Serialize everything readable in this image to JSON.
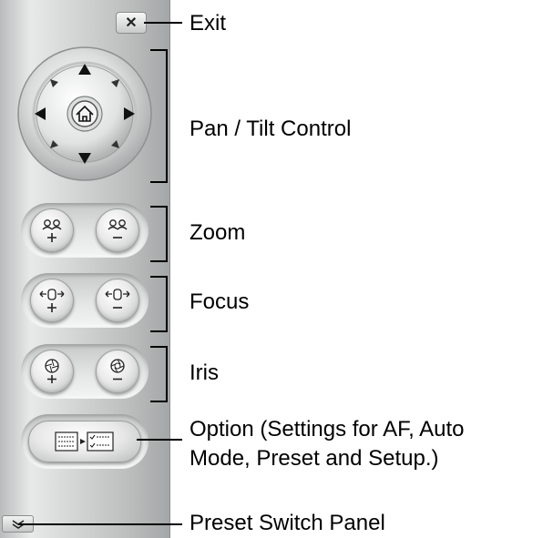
{
  "labels": {
    "exit": "Exit",
    "pan_tilt": "Pan / Tilt Control",
    "zoom": "Zoom",
    "focus": "Focus",
    "iris": "Iris",
    "option_line1": "Option (Settings for AF, Auto",
    "option_line2": "Mode, Preset and Setup.)",
    "preset_switch": "Preset Switch Panel"
  },
  "buttons": {
    "exit_symbol": "✕"
  }
}
